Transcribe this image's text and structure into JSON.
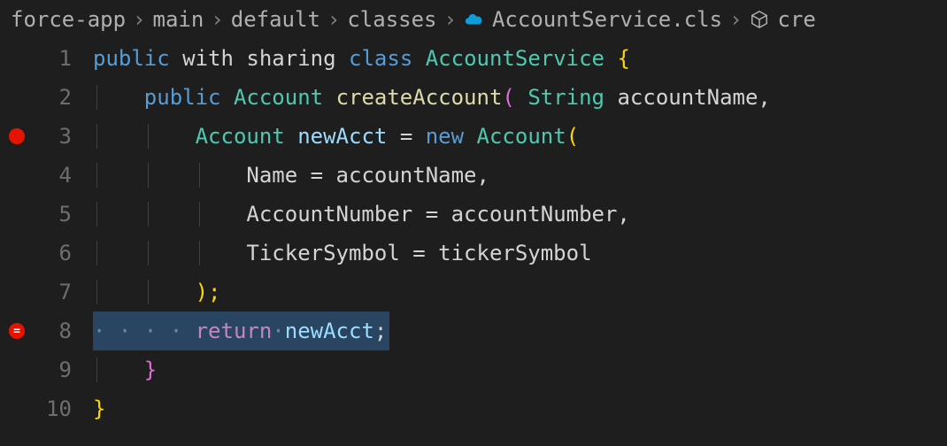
{
  "breadcrumb": {
    "items": [
      "force-app",
      "main",
      "default",
      "classes",
      "AccountService.cls",
      "cre"
    ],
    "separator": "›"
  },
  "lines": [
    {
      "num": "1"
    },
    {
      "num": "2"
    },
    {
      "num": "3"
    },
    {
      "num": "4"
    },
    {
      "num": "5"
    },
    {
      "num": "6"
    },
    {
      "num": "7"
    },
    {
      "num": "8"
    },
    {
      "num": "9"
    },
    {
      "num": "10"
    }
  ],
  "code": {
    "l1": {
      "public": "public",
      "with": "with",
      "sharing": "sharing",
      "class": "class",
      "name": "AccountService",
      "brace": "{"
    },
    "l2": {
      "public": "public",
      "type": "Account",
      "method": "createAccount",
      "paren": "(",
      "ptype": "String",
      "param": "accountName,"
    },
    "l3": {
      "type": "Account",
      "var": "newAcct",
      "eq": "=",
      "new": "new",
      "ctor": "Account",
      "paren": "("
    },
    "l4": {
      "field": "Name",
      "eq": "=",
      "val": "accountName,"
    },
    "l5": {
      "field": "AccountNumber",
      "eq": "=",
      "val": "accountNumber,"
    },
    "l6": {
      "field": "TickerSymbol",
      "eq": "=",
      "val": "tickerSymbol"
    },
    "l7": {
      "close": ");"
    },
    "l8": {
      "return": "return",
      "var": "newAcct",
      "semi": ";"
    },
    "l9": {
      "brace": "}"
    },
    "l10": {
      "brace": "}"
    }
  }
}
